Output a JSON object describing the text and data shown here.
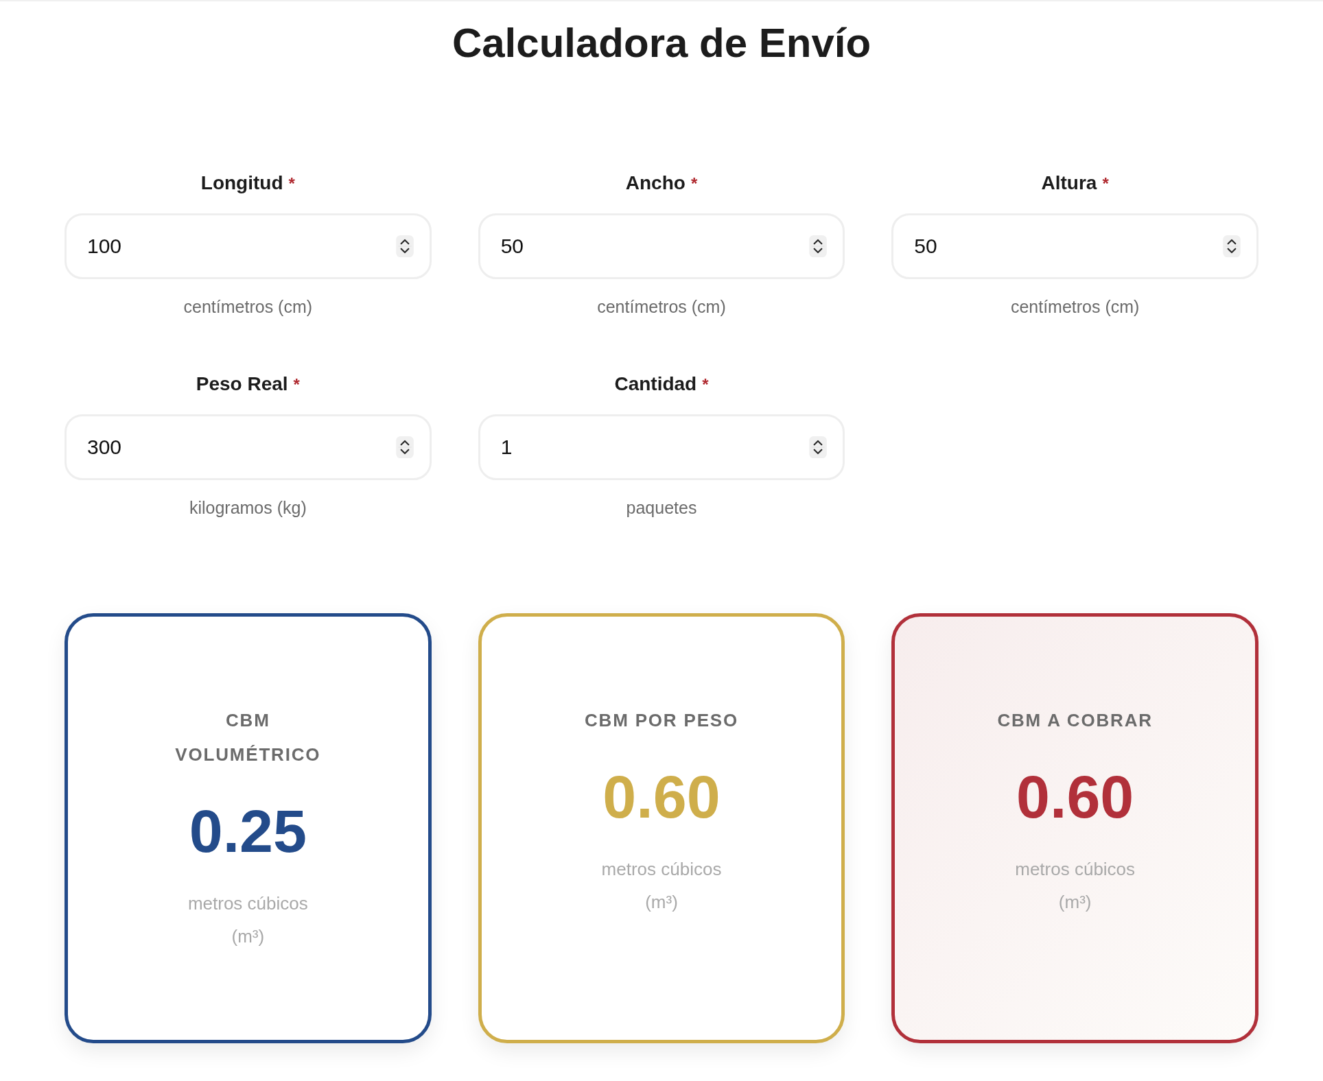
{
  "title": "Calculadora de Envío",
  "fields": [
    {
      "label": "Longitud",
      "required_mark": "*",
      "value": "100",
      "hint": "centímetros (cm)"
    },
    {
      "label": "Ancho",
      "required_mark": "*",
      "value": "50",
      "hint": "centímetros (cm)"
    },
    {
      "label": "Altura",
      "required_mark": "*",
      "value": "50",
      "hint": "centímetros (cm)"
    },
    {
      "label": "Peso Real",
      "required_mark": "*",
      "value": "300",
      "hint": "kilogramos (kg)"
    },
    {
      "label": "Cantidad",
      "required_mark": "*",
      "value": "1",
      "hint": "paquetes"
    }
  ],
  "results": [
    {
      "label": "CBM VOLUMÉTRICO",
      "value": "0.25",
      "unit": "metros cúbicos (m³)",
      "color": "#234b8a",
      "highlighted": false
    },
    {
      "label": "CBM POR PESO",
      "value": "0.60",
      "unit": "metros cúbicos (m³)",
      "color": "#cfae4b",
      "highlighted": false
    },
    {
      "label": "CBM A COBRAR",
      "value": "0.60",
      "unit": "metros cúbicos (m³)",
      "color": "#b1303a",
      "highlighted": true
    }
  ]
}
